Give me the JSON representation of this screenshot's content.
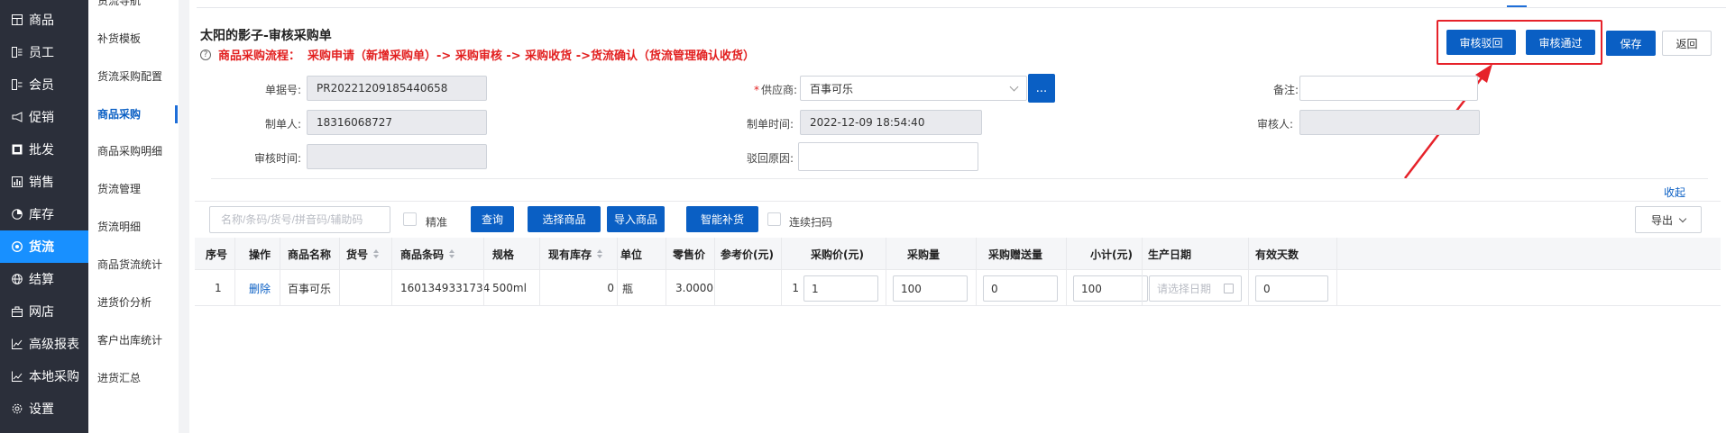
{
  "sidebar_primary": {
    "items": [
      {
        "label": "商品",
        "icon": "grid-icon"
      },
      {
        "label": "员工",
        "icon": "person-list-icon"
      },
      {
        "label": "会员",
        "icon": "member-icon"
      },
      {
        "label": "促销",
        "icon": "megaphone-icon"
      },
      {
        "label": "批发",
        "icon": "box-icon"
      },
      {
        "label": "销售",
        "icon": "bar-chart-icon"
      },
      {
        "label": "库存",
        "icon": "pie-icon"
      },
      {
        "label": "货流",
        "icon": "target-icon",
        "active": true
      },
      {
        "label": "结算",
        "icon": "globe-icon"
      },
      {
        "label": "网店",
        "icon": "store-icon"
      },
      {
        "label": "高级报表",
        "icon": "line-chart-icon"
      },
      {
        "label": "本地采购",
        "icon": "trend-icon"
      },
      {
        "label": "设置",
        "icon": "gear-icon"
      }
    ]
  },
  "sidebar_secondary": {
    "items": [
      {
        "label": "货流导航"
      },
      {
        "label": "补货模板"
      },
      {
        "label": "货流采购配置"
      },
      {
        "label": "商品采购",
        "active": true
      },
      {
        "label": "商品采购明细"
      },
      {
        "label": "货流管理"
      },
      {
        "label": "货流明细"
      },
      {
        "label": "商品货流统计"
      },
      {
        "label": "进货价分析"
      },
      {
        "label": "客户出库统计"
      },
      {
        "label": "进货汇总"
      }
    ]
  },
  "header": {
    "title": "太阳的影子-审核采购单",
    "flow_label": "商品采购流程：",
    "flow_text": "采购申请（新增采购单）-> 采购审核 -> 采购收货 ->货流确认（货流管理确认收货）"
  },
  "actions": {
    "reject_label": "审核驳回",
    "approve_label": "审核通过",
    "save_label": "保存",
    "back_label": "返回"
  },
  "form": {
    "order_no_label": "单据号:",
    "order_no": "PR20221209185440658",
    "supplier_label": "供应商:",
    "supplier_required": "*",
    "supplier": "百事可乐",
    "supplier_picker": "...",
    "remark_label": "备注:",
    "remark": "",
    "creator_label": "制单人:",
    "creator": "18316068727",
    "created_time_label": "制单时间:",
    "created_time": "2022-12-09 18:54:40",
    "auditor_label": "审核人:",
    "auditor": "",
    "audit_time_label": "审核时间:",
    "audit_time": "",
    "reject_reason_label": "驳回原因:",
    "reject_reason": ""
  },
  "collapse_label": "收起",
  "toolbar": {
    "search_placeholder": "名称/条码/货号/拼音码/辅助码",
    "exact_label": "精准",
    "query_label": "查询",
    "select_goods_label": "选择商品",
    "import_goods_label": "导入商品",
    "smart_restock_label": "智能补货",
    "continuous_scan_label": "连续扫码",
    "export_label": "导出"
  },
  "table": {
    "columns": [
      "序号",
      "操作",
      "商品名称",
      "货号",
      "商品条码",
      "规格",
      "现有库存",
      "单位",
      "零售价",
      "参考价(元)",
      "采购价(元)",
      "采购量",
      "采购赠送量",
      "小计(元)",
      "生产日期",
      "有效天数"
    ],
    "rows": [
      {
        "index": "1",
        "action": "删除",
        "name": "百事可乐",
        "item_no": "",
        "barcode": "1601349331734",
        "spec": "500ml",
        "stock": "0",
        "unit": "瓶",
        "retail_price": "3.0000",
        "ref_price": "1",
        "purchase_price": "1",
        "purchase_qty": "100",
        "gift_qty": "0",
        "subtotal": "100",
        "prod_date_placeholder": "请选择日期",
        "valid_days": "0"
      }
    ]
  },
  "colors": {
    "sidebar_bg": "#2b2f3a",
    "sidebar_active": "#1890ff",
    "primary_button": "#0a5fc4",
    "flow_text": "#e21f1f",
    "annotation_red": "#e6222a"
  }
}
